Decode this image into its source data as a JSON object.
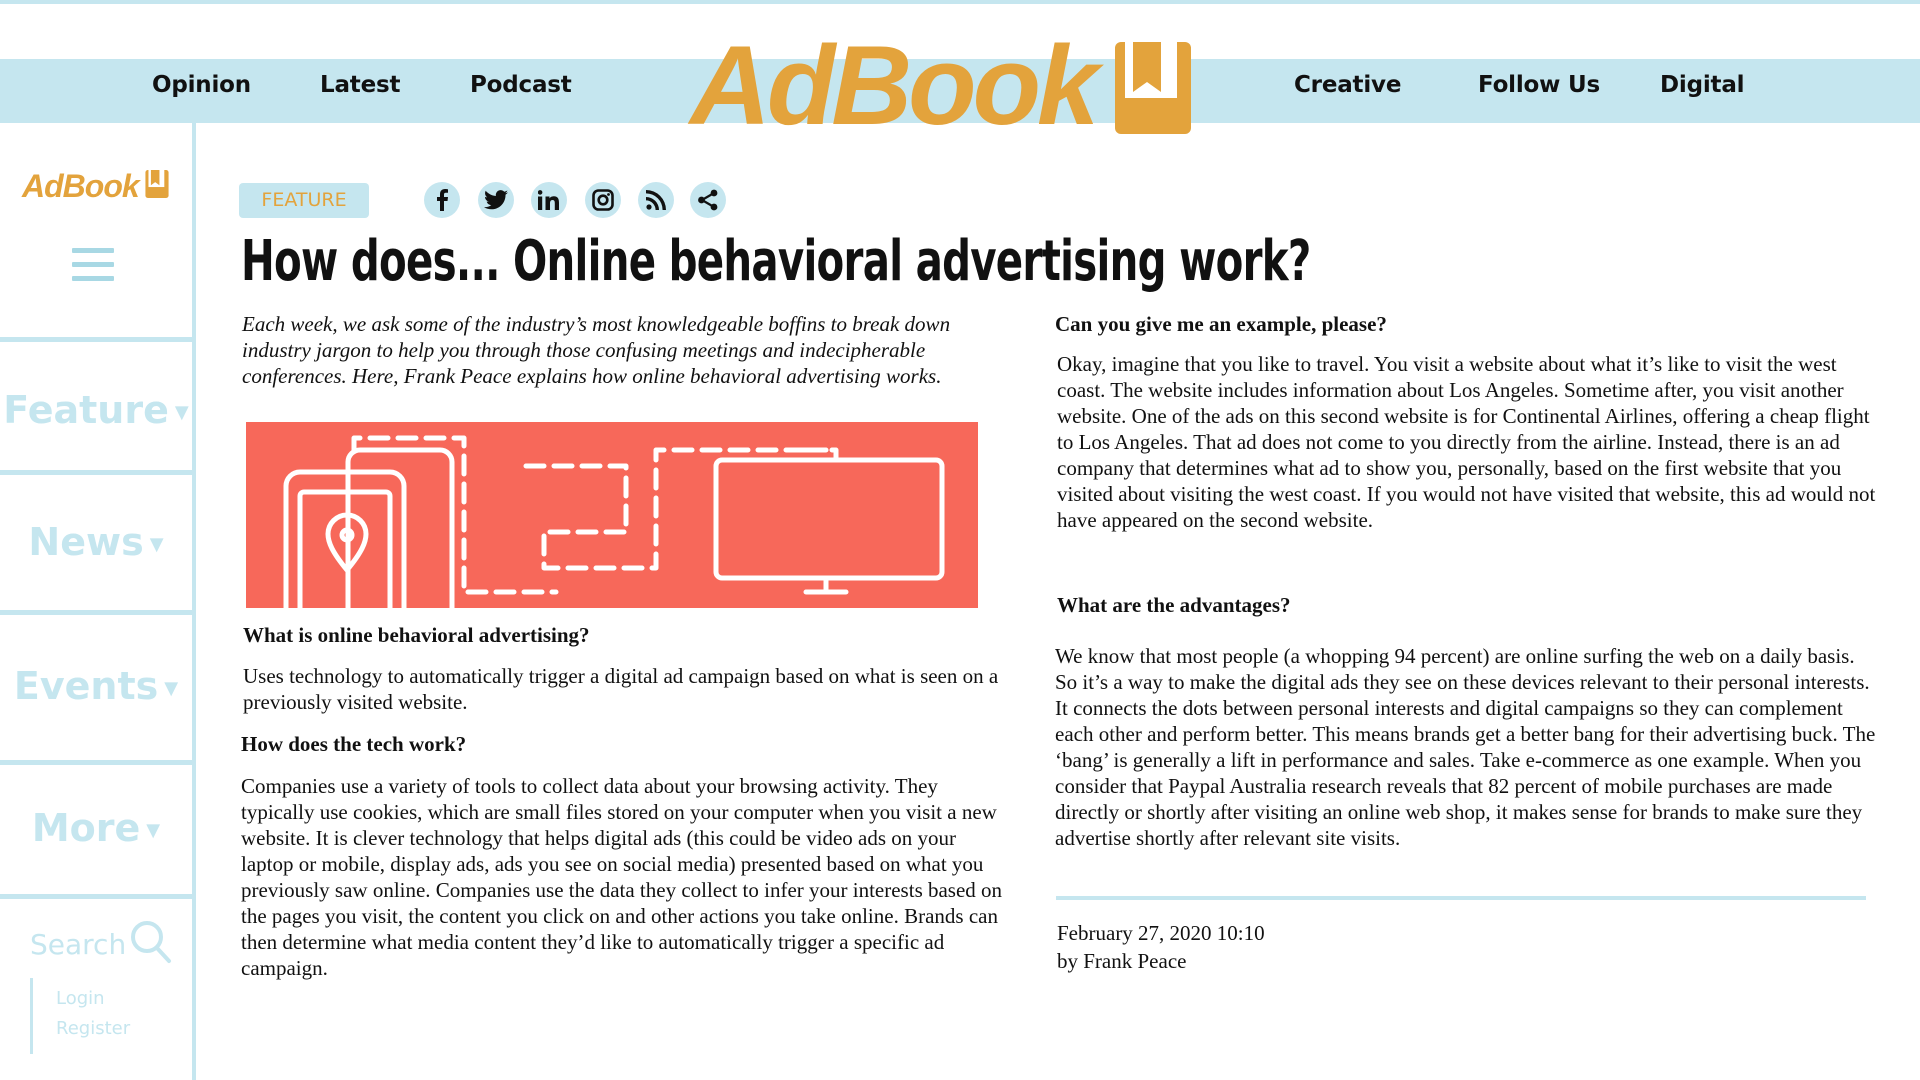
{
  "nav": {
    "left": [
      "Opinion",
      "Latest",
      "Podcast"
    ],
    "right": [
      "Creative",
      "Follow Us",
      "Digital"
    ]
  },
  "logo": {
    "text": "AdBook"
  },
  "sidebar": {
    "logo_text": "AdBook",
    "items": [
      {
        "label": "Feature"
      },
      {
        "label": "News"
      },
      {
        "label": "Events"
      },
      {
        "label": "More"
      }
    ],
    "search_label": "Search",
    "login": "Login",
    "register": "Register"
  },
  "article": {
    "badge": "FEATURE",
    "social_icons": [
      "facebook-icon",
      "twitter-icon",
      "linkedin-icon",
      "instagram-icon",
      "rss-icon",
      "share-icon"
    ],
    "title": "How does... Online behavioral advertising work?",
    "intro": "Each week, we ask some of the industry’s most knowledgeable boffins to break down industry jargon to help you through those confusing meetings and indecipherable conferences. Here, Frank Peace explains how online behavioral advertising works.",
    "sections": [
      {
        "heading": "What is online behavioral advertising?",
        "body": "Uses technology to automatically trigger a digital ad campaign based on what is seen on a previously visited website."
      },
      {
        "heading": "How does the tech work?",
        "body": "Companies use a variety of tools to collect data about your browsing activity. They typically use cookies, which are small files stored on your computer when you visit a new website. It is clever technology that helps digital ads (this could be video ads on your laptop or mobile, display ads, ads you see on social media) presented based on what you previously saw online. Companies use the data they collect to infer your interests based on the pages you visit, the content you click on and other actions you take online. Brands can then determine what media content they’d like to automatically trigger a specific ad campaign."
      },
      {
        "heading": "Can you give me an example, please?",
        "body": "Okay, imagine that you like to travel. You visit a website about what it’s like to visit the west coast. The website includes information about Los Angeles. Sometime after, you visit another website. One of the ads on this second website is for Continental Airlines, offering a cheap flight to Los Angeles. That ad does not come to you directly from the airline. Instead, there is an ad company that determines what ad to show you, personally, based on the first website that you visited about visiting the west coast. If you would not have visited that website, this ad would not have appeared on the second website."
      },
      {
        "heading": "What are the advantages?",
        "body": "We know that most people (a whopping 94 percent) are online surfing the web on a daily basis. So it’s a way to make the digital ads they see on these devices relevant to their personal interests. It connects the dots between personal interests and digital campaigns so they can complement each other and perform better. This means brands get a better bang for their advertising buck. The ‘bang’ is generally a lift in performance and sales. Take e-commerce as one example. When you consider that Paypal Australia research reveals that 82 percent of mobile purchases are made directly or shortly after visiting an online web shop, it makes sense for brands to make sure they advertise shortly after relevant site visits."
      }
    ],
    "date": "February 27, 2020 10:10",
    "byline": "by Frank Peace"
  },
  "colors": {
    "accent": "#e3a33c",
    "light_blue": "#c5e6ef",
    "hero_bg": "#f7685a"
  }
}
